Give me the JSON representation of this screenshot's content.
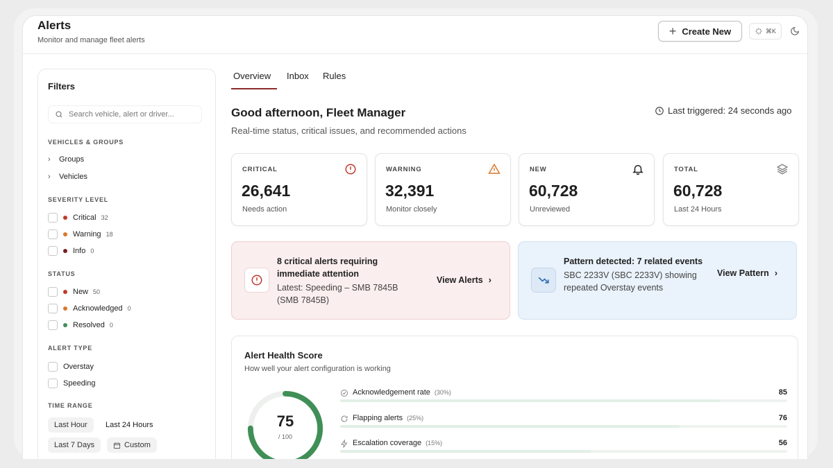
{
  "header": {
    "title": "Alerts",
    "subtitle": "Monitor and manage fleet alerts",
    "create_label": "Create New",
    "shortcut": "⌘K"
  },
  "filters": {
    "title": "Filters",
    "search_placeholder": "Search vehicle, alert or driver...",
    "vehicles_groups": {
      "label": "VEHICLES & GROUPS",
      "items": [
        "Groups",
        "Vehicles"
      ]
    },
    "severity": {
      "label": "SEVERITY LEVEL",
      "items": [
        {
          "label": "Critical",
          "count": "32",
          "color": "#c0392b"
        },
        {
          "label": "Warning",
          "count": "18",
          "color": "#d9782d"
        },
        {
          "label": "Info",
          "count": "0",
          "color": "#7a1f1f"
        }
      ]
    },
    "status": {
      "label": "STATUS",
      "items": [
        {
          "label": "New",
          "count": "50",
          "color": "#c0392b"
        },
        {
          "label": "Acknowledged",
          "count": "0",
          "color": "#d9782d"
        },
        {
          "label": "Resolved",
          "count": "0",
          "color": "#3f8f57"
        }
      ]
    },
    "alert_type": {
      "label": "ALERT TYPE",
      "items": [
        "Overstay",
        "Speeding"
      ]
    },
    "time_range": {
      "label": "TIME RANGE",
      "options": [
        "Last Hour",
        "Last 24 Hours",
        "Last 7 Days",
        "Custom"
      ],
      "selected": "Last 24 Hours"
    }
  },
  "tabs": [
    {
      "label": "Overview",
      "active": true
    },
    {
      "label": "Inbox",
      "active": false
    },
    {
      "label": "Rules",
      "active": false
    }
  ],
  "greeting": {
    "title": "Good afternoon, Fleet Manager",
    "subtitle": "Real-time status, critical issues, and recommended actions",
    "last_triggered": "Last triggered: 24 seconds ago"
  },
  "stats": [
    {
      "label": "CRITICAL",
      "value": "26,641",
      "note": "Needs action",
      "icon": "alert-circle-icon"
    },
    {
      "label": "WARNING",
      "value": "32,391",
      "note": "Monitor closely",
      "icon": "warning-triangle-icon"
    },
    {
      "label": "NEW",
      "value": "60,728",
      "note": "Unreviewed",
      "icon": "bell-icon"
    },
    {
      "label": "TOTAL",
      "value": "60,728",
      "note": "Last 24 Hours",
      "icon": "layers-icon"
    }
  ],
  "critical_banner": {
    "title_line1": "8 critical alerts requiring",
    "title_line2": "immediate attention",
    "text_line1": "Latest: Speeding – SMB 7845B",
    "text_line2": "(SMB 7845B)",
    "link": "View Alerts"
  },
  "pattern_banner": {
    "title": "Pattern detected: 7 related events",
    "text_line1": "SBC 2233V (SBC 2233V) showing",
    "text_line2": "repeated Overstay events",
    "link": "View Pattern"
  },
  "health": {
    "title": "Alert Health Score",
    "subtitle": "How well your alert configuration is working",
    "score": "75",
    "max": "/ 100",
    "score_fraction": 0.75,
    "metrics": [
      {
        "label": "Acknowledgement rate",
        "weight": "(30%)",
        "value": "85",
        "fraction": 0.85,
        "icon": "check-circle-icon"
      },
      {
        "label": "Flapping alerts",
        "weight": "(25%)",
        "value": "76",
        "fraction": 0.76,
        "icon": "refresh-icon"
      },
      {
        "label": "Escalation coverage",
        "weight": "(15%)",
        "value": "56",
        "fraction": 0.56,
        "icon": "bolt-icon"
      }
    ]
  }
}
